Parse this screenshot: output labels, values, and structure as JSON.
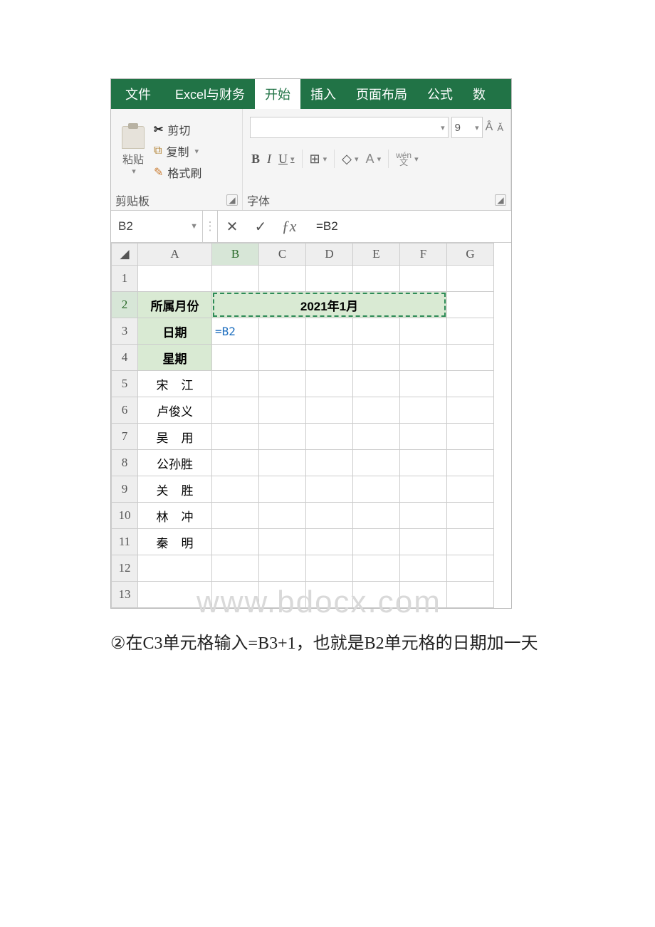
{
  "ribbon": {
    "tabs": {
      "file": "文件",
      "custom": "Excel与财务",
      "home": "开始",
      "insert": "插入",
      "layout": "页面布局",
      "formulas": "公式",
      "data": "数"
    },
    "clipboard": {
      "paste": "粘贴",
      "cut": "剪切",
      "copy": "复制",
      "format_painter": "格式刷",
      "group_label": "剪贴板"
    },
    "font": {
      "size": "9",
      "group_label": "字体",
      "wen_top": "wén",
      "wen_bottom": "文"
    }
  },
  "formula_bar": {
    "name_box": "B2",
    "formula": "=B2"
  },
  "columns": [
    "A",
    "B",
    "C",
    "D",
    "E",
    "F",
    "G"
  ],
  "rows": [
    "1",
    "2",
    "3",
    "4",
    "5",
    "6",
    "7",
    "8",
    "9",
    "10",
    "11",
    "12",
    "13"
  ],
  "cells": {
    "r2": {
      "A": "所属月份",
      "merged": "2021年1月"
    },
    "r3": {
      "A": "日期",
      "B": "=B2"
    },
    "r4": {
      "A": "星期"
    },
    "r5": {
      "A_spaced": "宋江",
      "A_chars": [
        "宋",
        "江"
      ]
    },
    "r6": {
      "A": "卢俊义"
    },
    "r7": {
      "A_spaced": "吴用",
      "A_chars": [
        "吴",
        "用"
      ]
    },
    "r8": {
      "A": "公孙胜"
    },
    "r9": {
      "A_spaced": "关胜",
      "A_chars": [
        "关",
        "胜"
      ]
    },
    "r10": {
      "A_spaced": "林冲",
      "A_chars": [
        "林",
        "冲"
      ]
    },
    "r11": {
      "A_spaced": "秦明",
      "A_chars": [
        "秦",
        "明"
      ]
    }
  },
  "watermark": "www.bdocx.com",
  "caption": {
    "bullet": "②",
    "t1": "在 ",
    "c3": "C3 ",
    "t2": "单元格输入",
    "formula": "=B3+1",
    "t3": "，也就是 ",
    "b2": "B2 ",
    "t4": "单元格的日期加一天"
  }
}
